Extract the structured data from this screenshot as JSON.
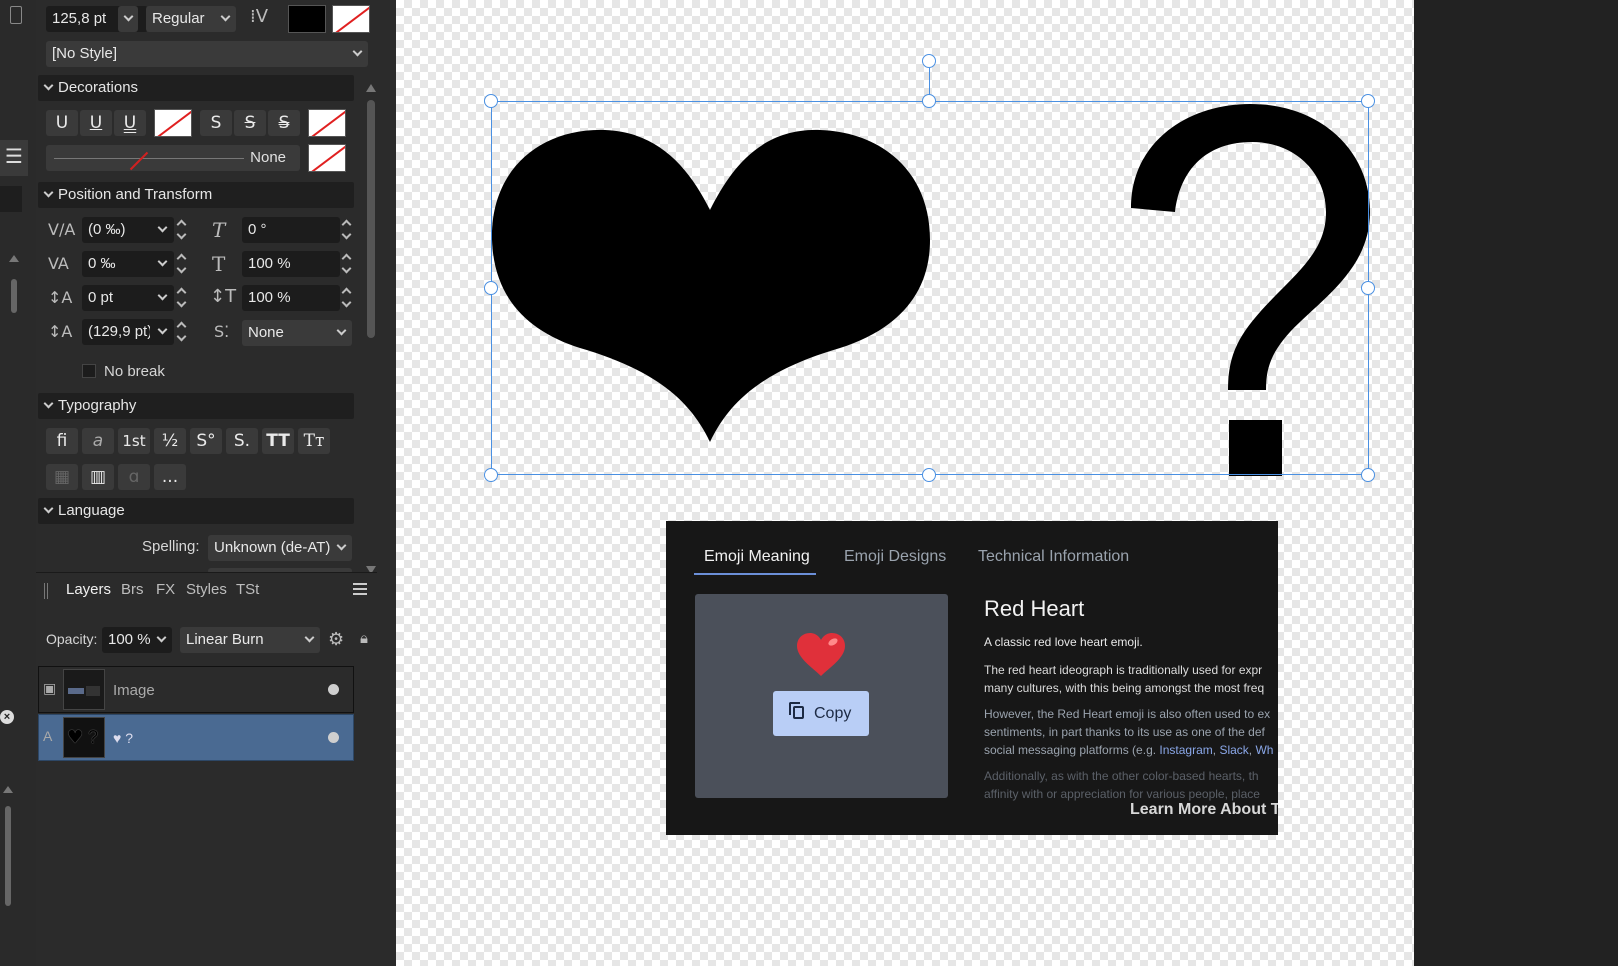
{
  "toolbar": {
    "font_size": "125,8 pt",
    "font_weight": "Regular",
    "paragraph_style": "[No Style]"
  },
  "decorations": {
    "header": "Decorations",
    "line_value": "None"
  },
  "position_transform": {
    "header": "Position and Transform",
    "kerning": "(0 ‰)",
    "tracking": "0 ‰",
    "baseline": "0 pt",
    "leading": "(129,9 pt)",
    "shear": "0 °",
    "vscale": "100 %",
    "hscale": "100 %",
    "small_caps": "None",
    "no_break_label": "No break"
  },
  "typography": {
    "header": "Typography",
    "buttons": [
      "fi",
      "a",
      "1st",
      "½",
      "S°",
      "S.",
      "TT",
      "Tт"
    ],
    "more": "..."
  },
  "language": {
    "header": "Language",
    "spelling_label": "Spelling:",
    "spelling_value": "Unknown (de-AT)"
  },
  "layers_panel": {
    "tabs": [
      "Layers",
      "Brs",
      "FX",
      "Styles",
      "TSt"
    ],
    "opacity_label": "Opacity:",
    "opacity_value": "100 %",
    "blend_mode": "Linear Burn",
    "layers": [
      {
        "name": "Image",
        "icon": "image-layer-icon"
      },
      {
        "name": "♥ ?",
        "icon": "text-layer-icon",
        "prefix": "A"
      }
    ]
  },
  "canvas": {
    "text_content": "♥ ?"
  },
  "emoji_card": {
    "tabs": [
      "Emoji Meaning",
      "Emoji Designs",
      "Technical Information"
    ],
    "copy_label": "Copy",
    "title": "Red Heart",
    "subtitle": "A classic red love heart emoji.",
    "para1_line1": "The red heart ideograph is traditionally used for expr",
    "para1_line2": "many cultures, with this being amongst the most freq",
    "para2_line1": "However, the Red Heart emoji is also often used to ex",
    "para2_line2": "sentiments, in part thanks to its use as one of the def",
    "para2_line3_prefix": "social messaging platforms (e.g. ",
    "link_instagram": "Instagram",
    "link_slack": "Slack",
    "link_wh": "Wh",
    "para3_line1": "Additionally, as with the other color-based hearts, th",
    "para3_line2": "affinity with or appreciation for various people, place",
    "learn_more": "Learn More About Th"
  },
  "colors": {
    "selection": "#4a90e2",
    "card_bg": "#171717",
    "copy_button": "#b9cef6",
    "layer_selected": "#4a6a92"
  }
}
